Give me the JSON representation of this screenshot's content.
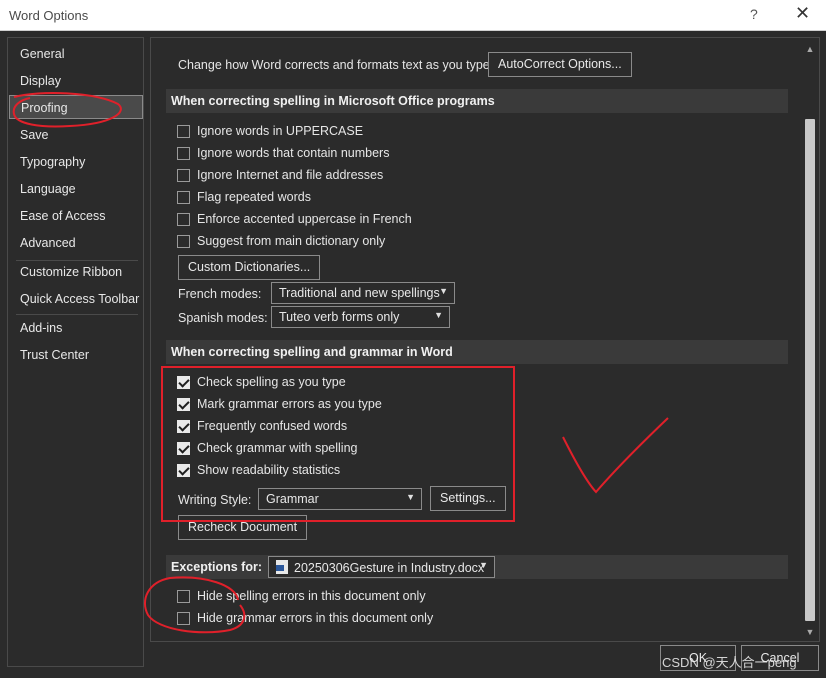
{
  "window": {
    "title": "Word Options",
    "help_glyph": "?",
    "close_glyph": "✕"
  },
  "sidebar": {
    "items": [
      {
        "label": "General"
      },
      {
        "label": "Display"
      },
      {
        "label": "Proofing"
      },
      {
        "label": "Save"
      },
      {
        "label": "Typography"
      },
      {
        "label": "Language"
      },
      {
        "label": "Ease of Access"
      },
      {
        "label": "Advanced"
      },
      {
        "label": "Customize Ribbon"
      },
      {
        "label": "Quick Access Toolbar"
      },
      {
        "label": "Add-ins"
      },
      {
        "label": "Trust Center"
      }
    ],
    "active_index": 2
  },
  "autocorrect": {
    "label": "Change how Word corrects and formats text as you type:",
    "button": "AutoCorrect Options..."
  },
  "office_section": {
    "header": "When correcting spelling in Microsoft Office programs",
    "options": [
      {
        "label": "Ignore words in UPPERCASE",
        "checked": false
      },
      {
        "label": "Ignore words that contain numbers",
        "checked": false
      },
      {
        "label": "Ignore Internet and file addresses",
        "checked": false
      },
      {
        "label": "Flag repeated words",
        "checked": false
      },
      {
        "label": "Enforce accented uppercase in French",
        "checked": false
      },
      {
        "label": "Suggest from main dictionary only",
        "checked": false
      }
    ],
    "custom_dictionaries_button": "Custom Dictionaries...",
    "french_modes_label": "French modes:",
    "french_modes_value": "Traditional and new spellings",
    "spanish_modes_label": "Spanish modes:",
    "spanish_modes_value": "Tuteo verb forms only"
  },
  "word_section": {
    "header": "When correcting spelling and grammar in Word",
    "options": [
      {
        "label": "Check spelling as you type",
        "checked": true
      },
      {
        "label": "Mark grammar errors as you type",
        "checked": true
      },
      {
        "label": "Frequently confused words",
        "checked": true
      },
      {
        "label": "Check grammar with spelling",
        "checked": true
      },
      {
        "label": "Show readability statistics",
        "checked": true
      }
    ],
    "writing_style_label": "Writing Style:",
    "writing_style_value": "Grammar",
    "settings_button": "Settings...",
    "recheck_button": "Recheck Document"
  },
  "exceptions": {
    "label": "Exceptions for:",
    "document": "20250306Gesture in Industry.docx",
    "options": [
      {
        "label": "Hide spelling errors in this document only",
        "checked": false
      },
      {
        "label": "Hide grammar errors in this document only",
        "checked": false
      }
    ]
  },
  "footer": {
    "ok": "OK",
    "cancel": "Cancel"
  },
  "watermark": "CSDN @天人合一peng",
  "colors": {
    "annotation": "#e0202a",
    "checkbox_on": "#e9e9e9",
    "section_bg": "#3a3a3a"
  }
}
